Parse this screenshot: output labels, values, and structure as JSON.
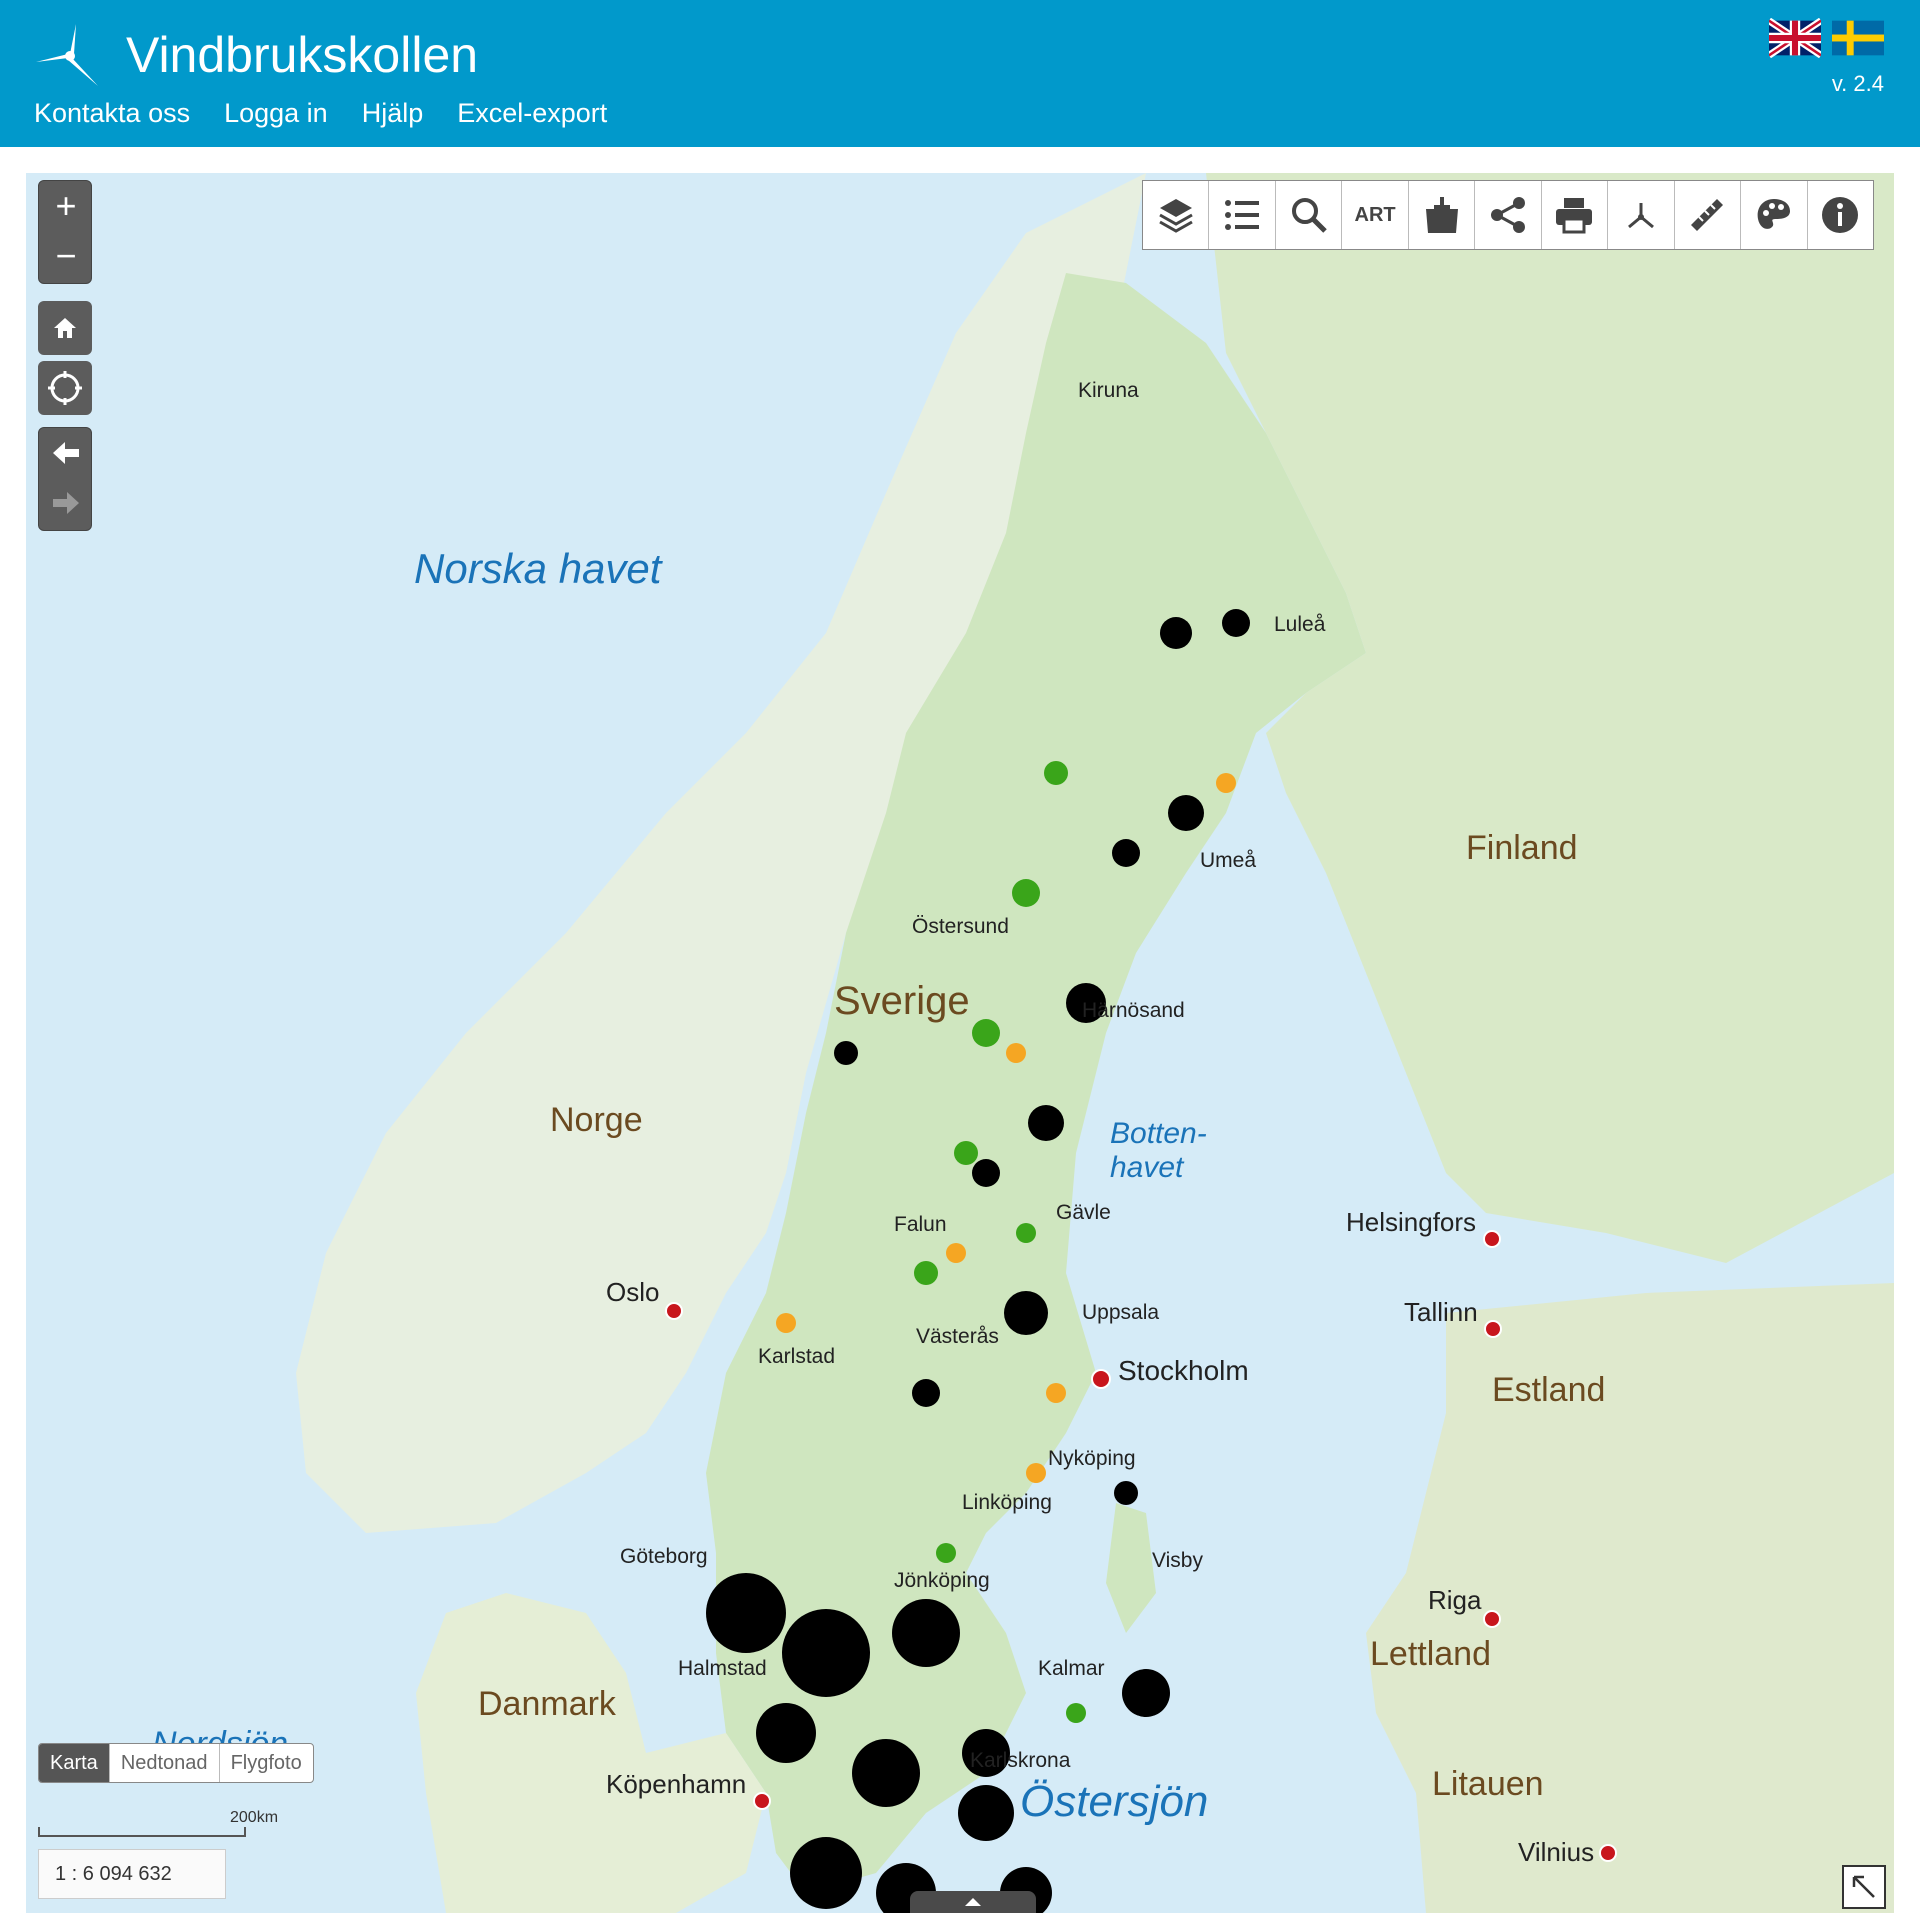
{
  "header": {
    "title": "Vindbrukskollen",
    "nav": [
      "Kontakta oss",
      "Logga in",
      "Hjälp",
      "Excel-export"
    ],
    "version": "v. 2.4",
    "languages": [
      "english-flag",
      "swedish-flag"
    ],
    "background_color": "#0199cb"
  },
  "toolbar": {
    "tools": [
      "layers-icon",
      "legend-list-icon",
      "search-icon",
      "ART",
      "add-data-icon",
      "share-icon",
      "print-icon",
      "coordinates-xyz-icon",
      "measure-ruler-icon",
      "style-palette-icon",
      "info-icon"
    ]
  },
  "map_controls": {
    "zoom_in": "+",
    "zoom_out": "−"
  },
  "basemaps": {
    "options": [
      "Karta",
      "Nedtonad",
      "Flygfoto"
    ],
    "selected": "Karta"
  },
  "scale": {
    "bar_label": "200km",
    "ratio": "1 : 6 094 632"
  },
  "map_labels": {
    "seas": [
      "Norska havet",
      "Botten-",
      "havet",
      "Östersjön",
      "Nordsjön"
    ],
    "countries": [
      "Sverige",
      "Norge",
      "Finland",
      "Estland",
      "Lettland",
      "Litauen",
      "Danmark"
    ],
    "capitals": [
      "Oslo",
      "Stockholm",
      "Helsingfors",
      "Tallinn",
      "Riga",
      "Vilnius",
      "Köpenhamn"
    ],
    "cities": [
      "Kiruna",
      "Luleå",
      "Umeå",
      "Östersund",
      "Härnösand",
      "Gävle",
      "Falun",
      "Uppsala",
      "Västerås",
      "Karlstad",
      "Nyköping",
      "Linköping",
      "Göteborg",
      "Jönköping",
      "Halmstad",
      "Kalmar",
      "Karlskrona",
      "Visby"
    ]
  },
  "turbine_status_colors": {
    "built": "#000000",
    "approved": "#3aa51a",
    "planned": "#f5a623"
  }
}
